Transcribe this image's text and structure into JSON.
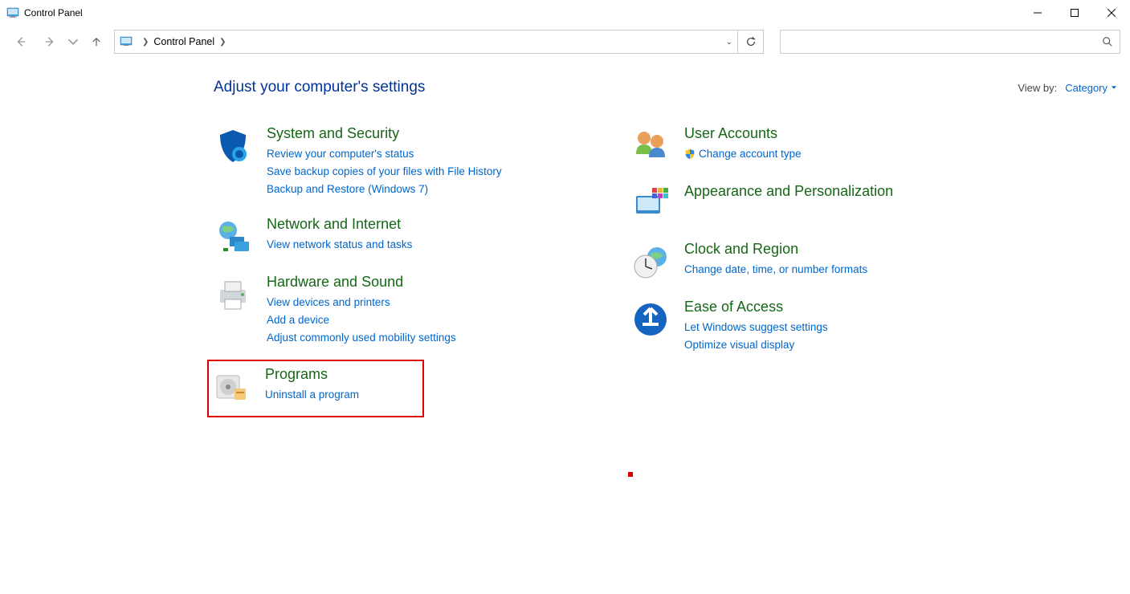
{
  "window": {
    "title": "Control Panel"
  },
  "breadcrumb": {
    "root": "Control Panel"
  },
  "header": {
    "title": "Adjust your computer's settings",
    "viewby_label": "View by:",
    "viewby_value": "Category"
  },
  "left": [
    {
      "title": "System and Security",
      "links": [
        "Review your computer's status",
        "Save backup copies of your files with File History",
        "Backup and Restore (Windows 7)"
      ]
    },
    {
      "title": "Network and Internet",
      "links": [
        "View network status and tasks"
      ]
    },
    {
      "title": "Hardware and Sound",
      "links": [
        "View devices and printers",
        "Add a device",
        "Adjust commonly used mobility settings"
      ]
    },
    {
      "title": "Programs",
      "links": [
        "Uninstall a program"
      ],
      "highlighted": true
    }
  ],
  "right": [
    {
      "title": "User Accounts",
      "links": [
        "Change account type"
      ],
      "shield": [
        true
      ]
    },
    {
      "title": "Appearance and Personalization",
      "links": []
    },
    {
      "title": "Clock and Region",
      "links": [
        "Change date, time, or number formats"
      ]
    },
    {
      "title": "Ease of Access",
      "links": [
        "Let Windows suggest settings",
        "Optimize visual display"
      ]
    }
  ]
}
